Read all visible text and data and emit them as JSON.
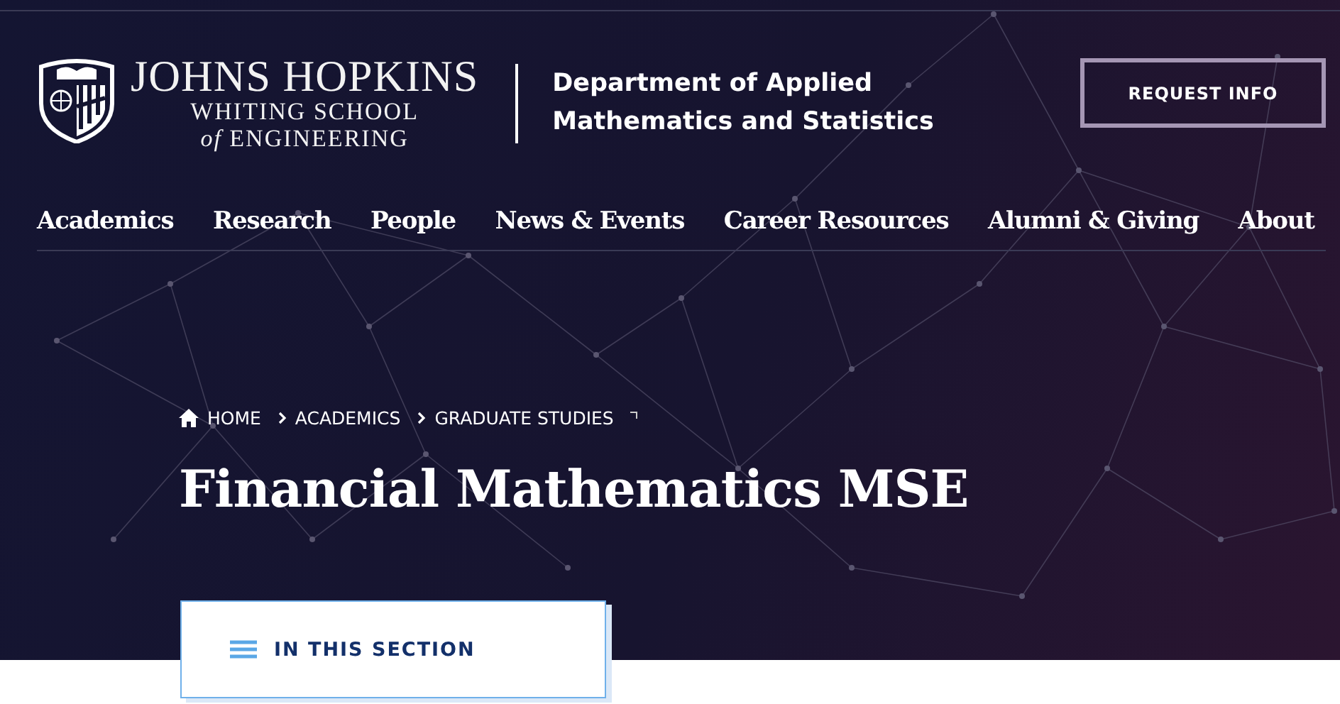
{
  "logo": {
    "name": "JOHNS HOPKINS",
    "line_1": "WHITING SCHOOL",
    "line_2": "*of* ENGINEERING"
  },
  "department": {
    "line_1": "Department of Applied",
    "line_2": "Mathematics and Statistics"
  },
  "request_button": "REQUEST INFO",
  "nav": [
    "Academics",
    "Research",
    "People",
    "News & Events",
    "Career Resources",
    "Alumni & Giving",
    "About"
  ],
  "breadcrumb": [
    "HOME",
    "ACADEMICS",
    "GRADUATE STUDIES"
  ],
  "page_title": "Financial Mathematics MSE",
  "section_menu": {
    "label": "IN THIS SECTION",
    "expanded": false
  }
}
